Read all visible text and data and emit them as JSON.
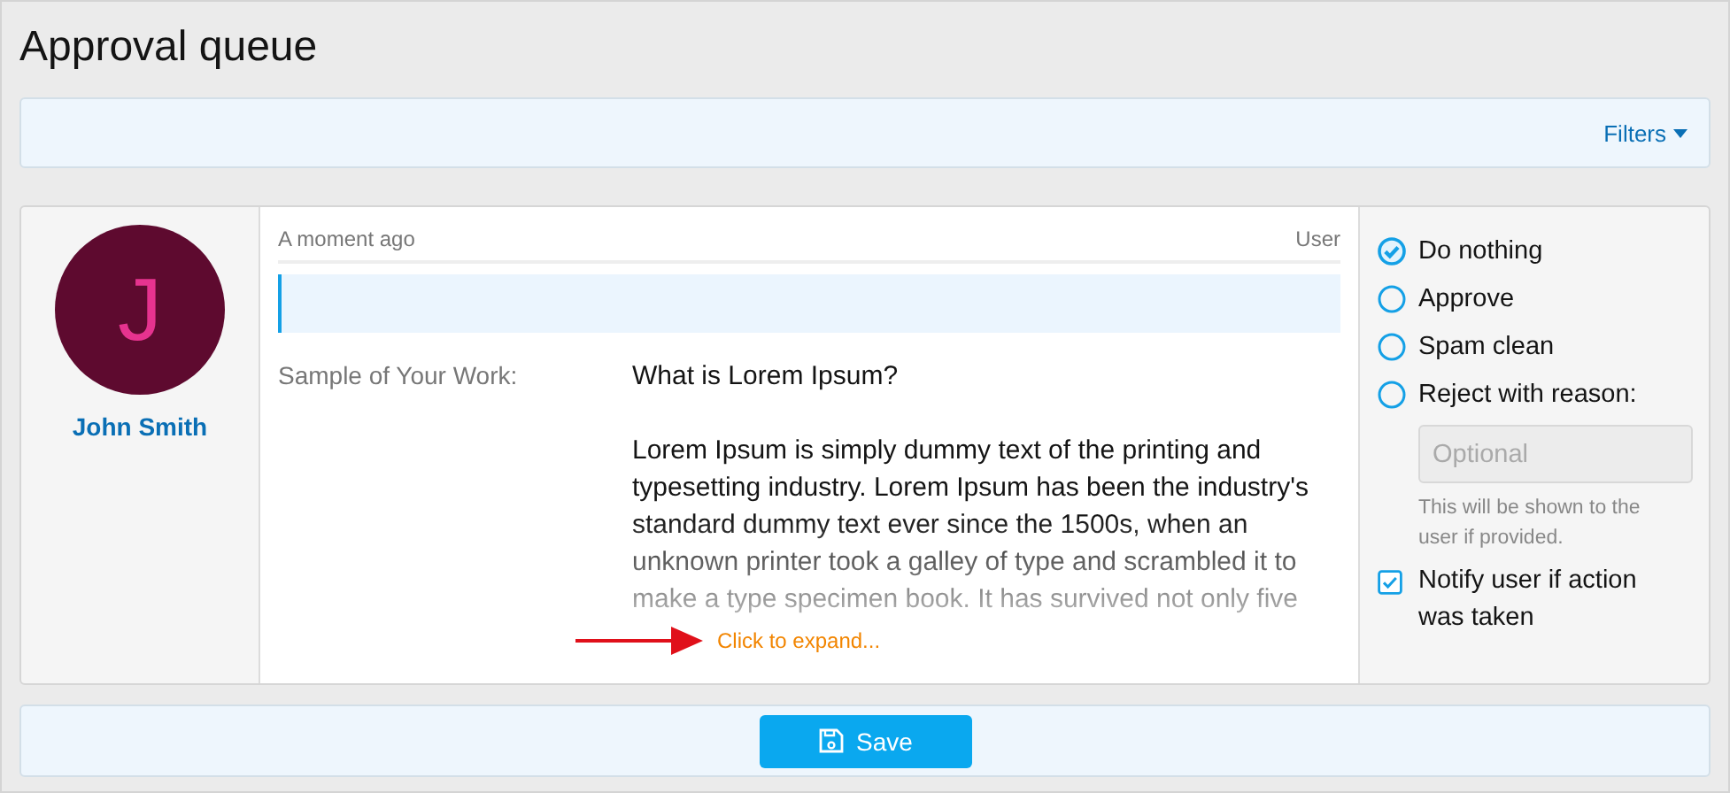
{
  "title": "Approval queue",
  "filters": {
    "label": "Filters"
  },
  "item": {
    "user": {
      "initial": "J",
      "name": "John Smith"
    },
    "time": "A moment ago",
    "role": "User",
    "field": {
      "label": "Sample of Your Work:",
      "heading": "What is Lorem Ipsum?",
      "body": "Lorem Ipsum is simply dummy text of the printing and typesetting industry. Lorem Ipsum has been the industry's standard dummy text ever since the 1500s, when an unknown printer took a galley of type and scrambled it to make a type specimen book. It has survived not only five"
    },
    "expand_link": "Click to expand...",
    "actions": [
      {
        "label": "Do nothing",
        "selected": true
      },
      {
        "label": "Approve",
        "selected": false
      },
      {
        "label": "Spam clean",
        "selected": false
      },
      {
        "label": "Reject with reason:",
        "selected": false
      }
    ],
    "reason": {
      "placeholder": "Optional",
      "hint": "This will be shown to the user if provided."
    },
    "notify": {
      "label": "Notify user if action was taken",
      "checked": true
    }
  },
  "save": {
    "label": "Save"
  }
}
